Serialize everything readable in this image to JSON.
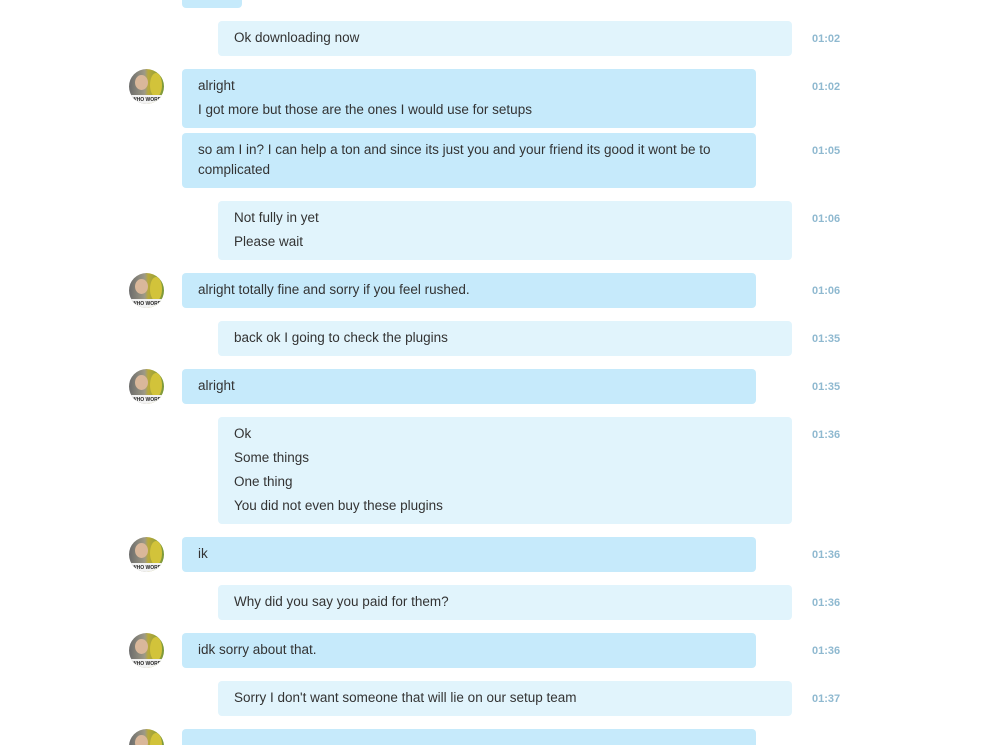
{
  "colors": {
    "incoming_bubble": "#c6eafb",
    "outgoing_bubble": "#e1f4fc",
    "timestamp": "#8fb9d0",
    "text": "#333333"
  },
  "avatar_caption": "WHO WORE",
  "messages": [
    {
      "lines": [
        "Ok downloading now"
      ],
      "time": "01:02"
    },
    {
      "lines": [
        "alright",
        "I got more but those are the ones I would use for setups"
      ],
      "time": "01:02"
    },
    {
      "lines": [
        "so am I in? I can help a ton and since its just you and your friend its good it wont be to complicated"
      ],
      "time": "01:05"
    },
    {
      "lines": [
        "Not fully in yet",
        "Please wait"
      ],
      "time": "01:06"
    },
    {
      "lines": [
        "alright totally fine and sorry if you feel rushed."
      ],
      "time": "01:06"
    },
    {
      "lines": [
        "back ok I going to check the plugins"
      ],
      "time": "01:35"
    },
    {
      "lines": [
        "alright"
      ],
      "time": "01:35"
    },
    {
      "lines": [
        "Ok",
        "Some things",
        "One thing",
        "You did not even buy these plugins"
      ],
      "time": "01:36"
    },
    {
      "lines": [
        "ik"
      ],
      "time": "01:36"
    },
    {
      "lines": [
        "Why did you say you paid for them?"
      ],
      "time": "01:36"
    },
    {
      "lines": [
        "idk sorry about that."
      ],
      "time": "01:36"
    },
    {
      "lines": [
        "Sorry I don't want someone that will lie on our setup team"
      ],
      "time": "01:37"
    }
  ]
}
